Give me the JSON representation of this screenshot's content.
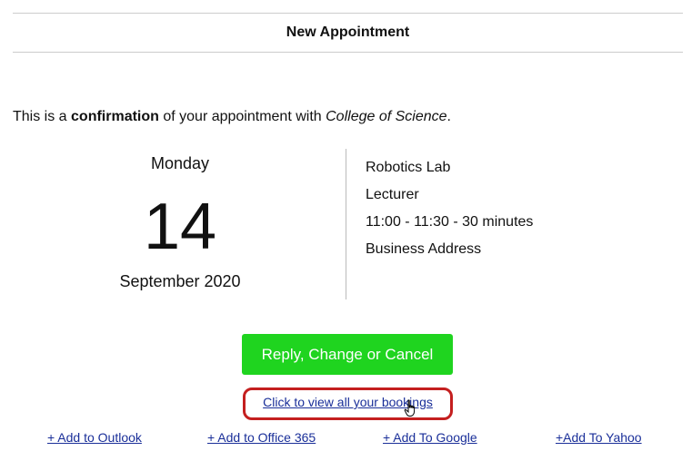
{
  "header": {
    "title": "New Appointment"
  },
  "intro": {
    "prefix": "This is a ",
    "emphasis": "confirmation",
    "middle": " of your appointment with ",
    "organization": "College of Science",
    "suffix": "."
  },
  "appointment": {
    "weekday": "Monday",
    "day": "14",
    "month_year": "September 2020",
    "location": "Robotics Lab",
    "staff": "Lecturer",
    "time": "11:00 - 11:30 - 30 minutes",
    "address": "Business Address"
  },
  "actions": {
    "primary_button": "Reply, Change or Cancel",
    "bookings_link": "Click to view all your bookings"
  },
  "calendar_links": {
    "outlook": "+ Add to Outlook",
    "office365": "+ Add to Office 365",
    "google": "+ Add To Google",
    "yahoo": "+Add To Yahoo"
  },
  "colors": {
    "primary_button": "#1fd41f",
    "link": "#1a2f99",
    "highlight_outline": "#c41f1f"
  },
  "icons": {
    "cursor": "hand-pointer-icon"
  }
}
